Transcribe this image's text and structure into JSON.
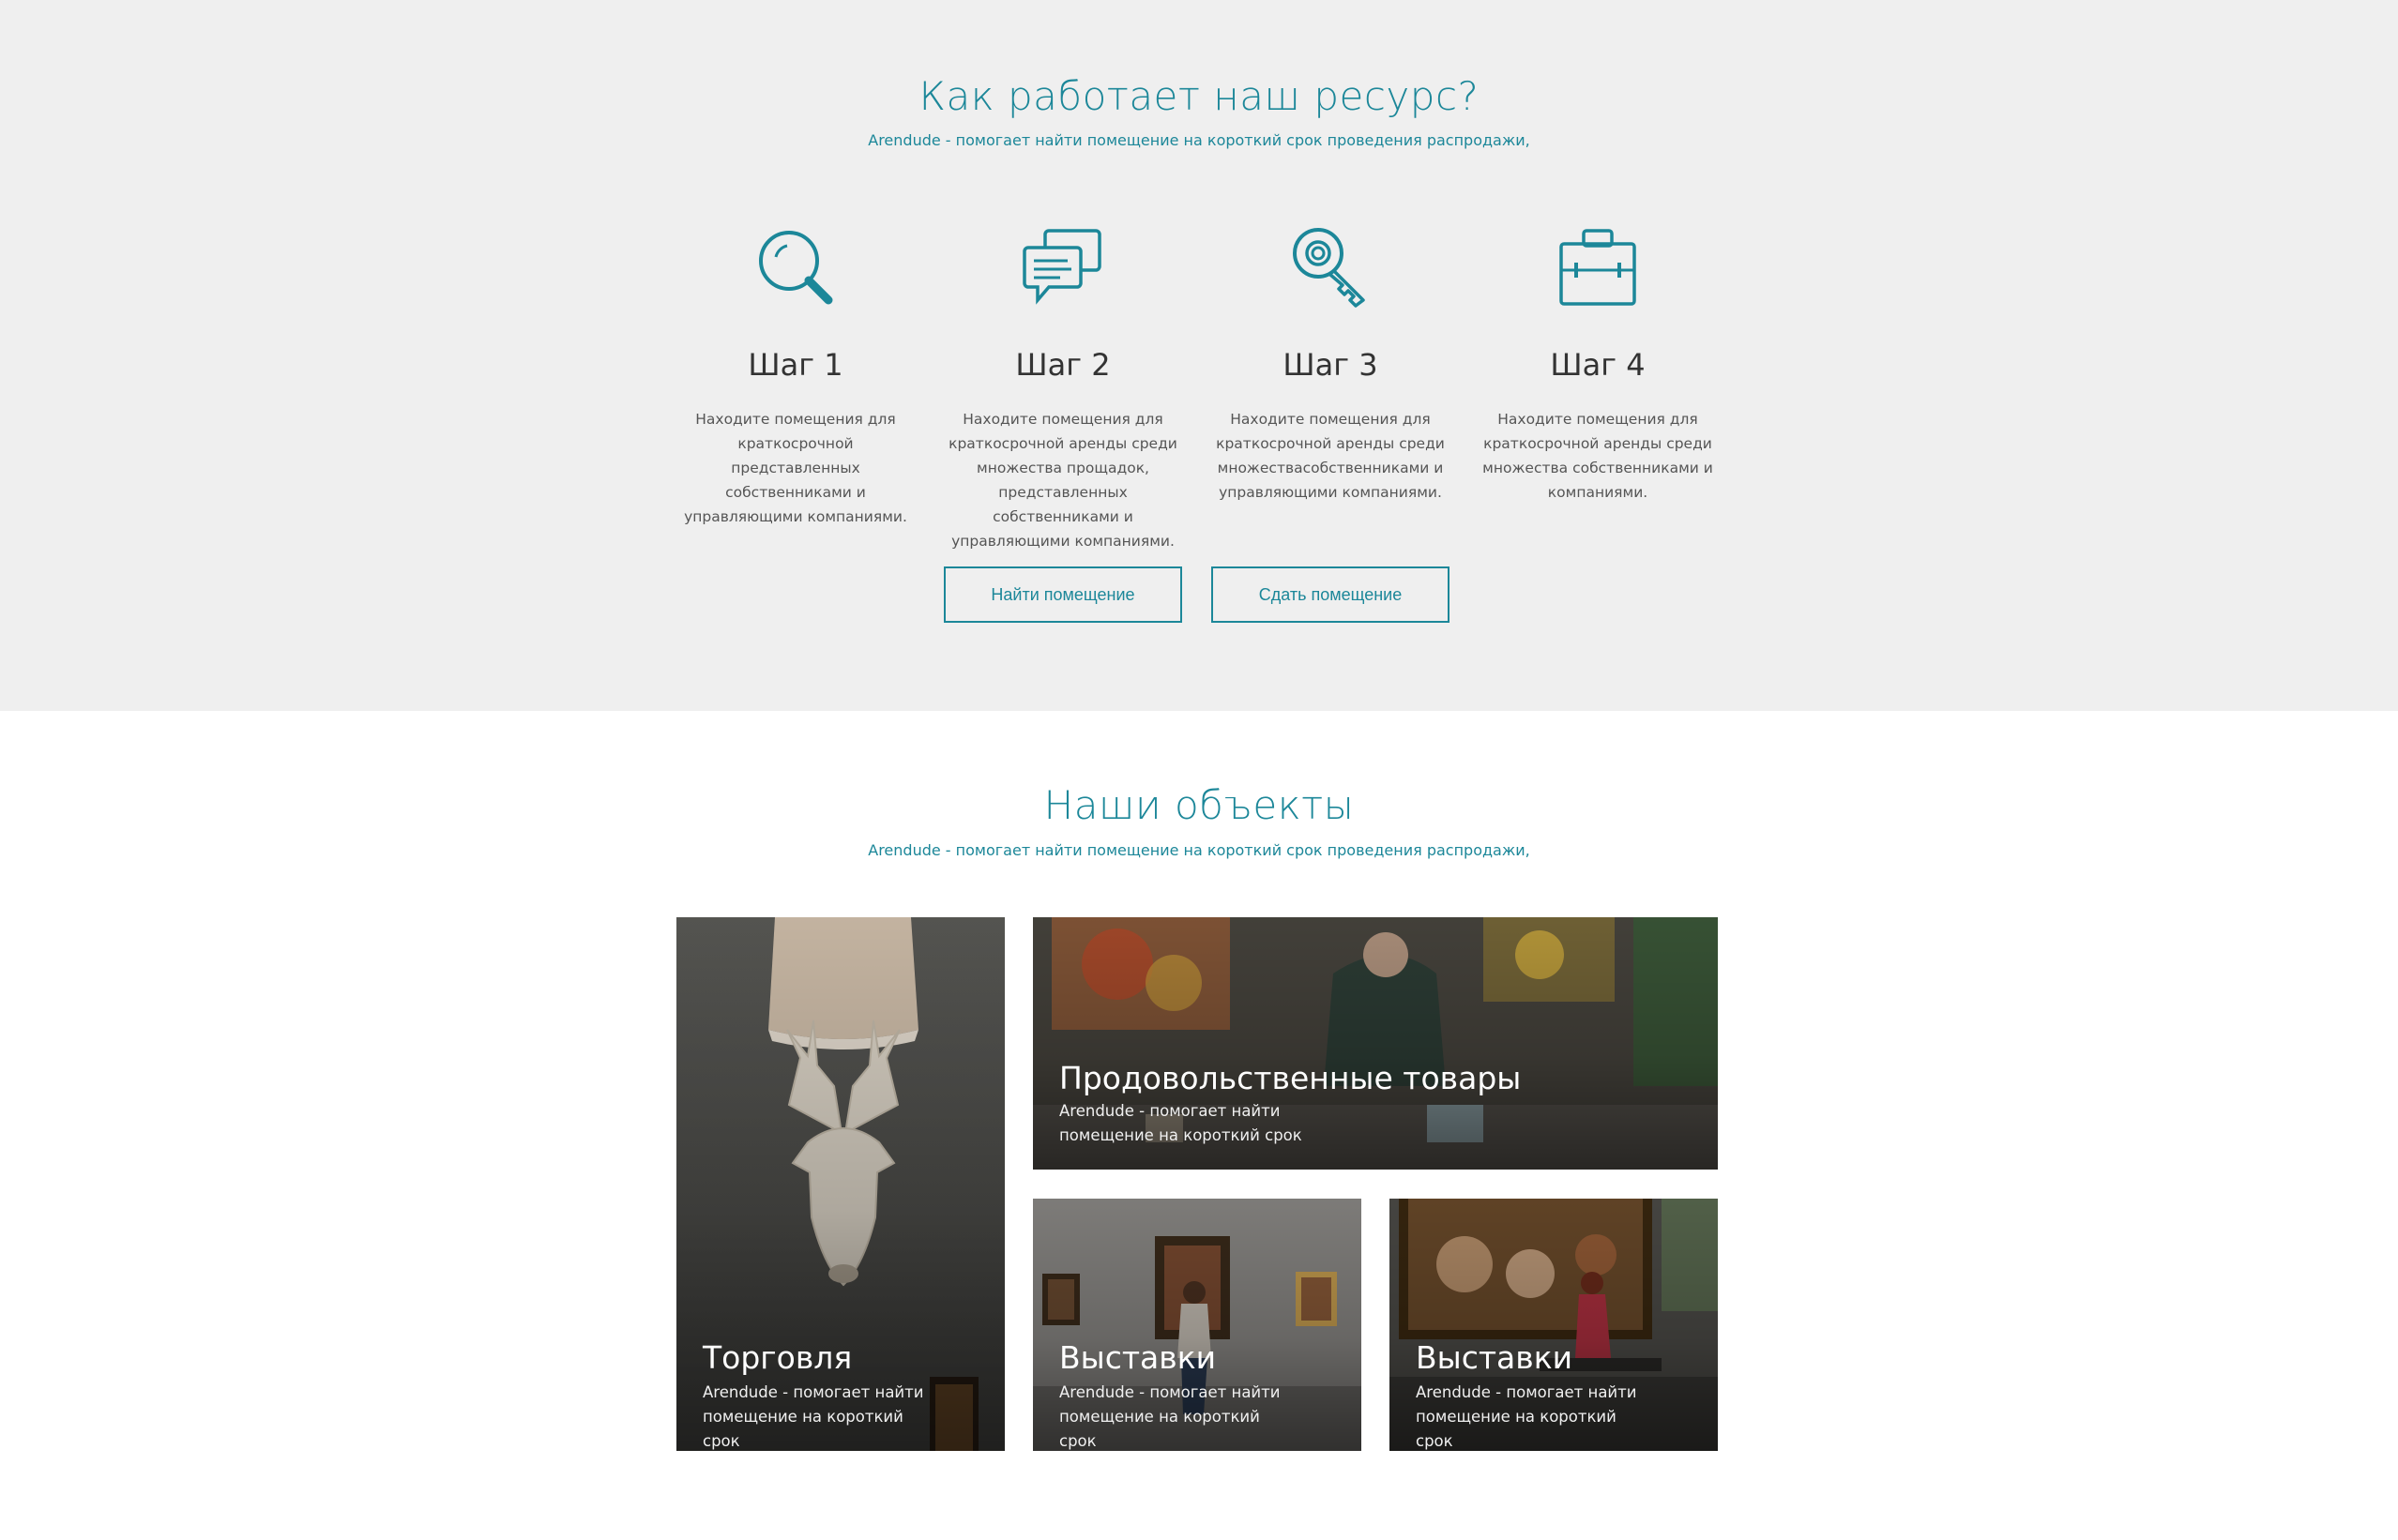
{
  "how": {
    "title": "Как работает наш ресурс?",
    "subtitle": "Arendude - помогает найти помещение на короткий срок проведения распродажи,",
    "steps": [
      {
        "icon": "search-icon",
        "name": "Шаг 1",
        "desc": "Находите помещения для краткосрочной представленных собственниками и управляющими компаниями."
      },
      {
        "icon": "chat-icon",
        "name": "Шаг 2",
        "desc": "Находите помещения для краткосрочной аренды среди множества прощадок, представленных собственниками и  управляющими компаниями."
      },
      {
        "icon": "key-icon",
        "name": "Шаг 3",
        "desc": "Находите помещения для краткосрочной аренды среди множествасобственниками и управляющими компаниями."
      },
      {
        "icon": "briefcase-icon",
        "name": "Шаг 4",
        "desc": "Находите помещения для краткосрочной аренды среди множества собственниками и компаниями."
      }
    ],
    "buttons": {
      "find": "Найти помещение",
      "rent": "Сдать помещение"
    }
  },
  "objects": {
    "title": "Наши объекты",
    "subtitle": "Arendude - помогает найти помещение на короткий срок проведения распродажи,",
    "tiles": [
      {
        "title": "Торговля",
        "text": "Arendude - помогает найти помещение на короткий срок"
      },
      {
        "title": "Продовольственные товары",
        "text": "Arendude - помогает найти помещение на короткий срок"
      },
      {
        "title": "Выставки",
        "text": "Arendude - помогает найти помещение на короткий срок"
      },
      {
        "title": "Выставки",
        "text": "Arendude - помогает найти помещение на короткий срок"
      }
    ]
  },
  "colors": {
    "accent": "#1c8799",
    "section_bg": "#efefef"
  }
}
